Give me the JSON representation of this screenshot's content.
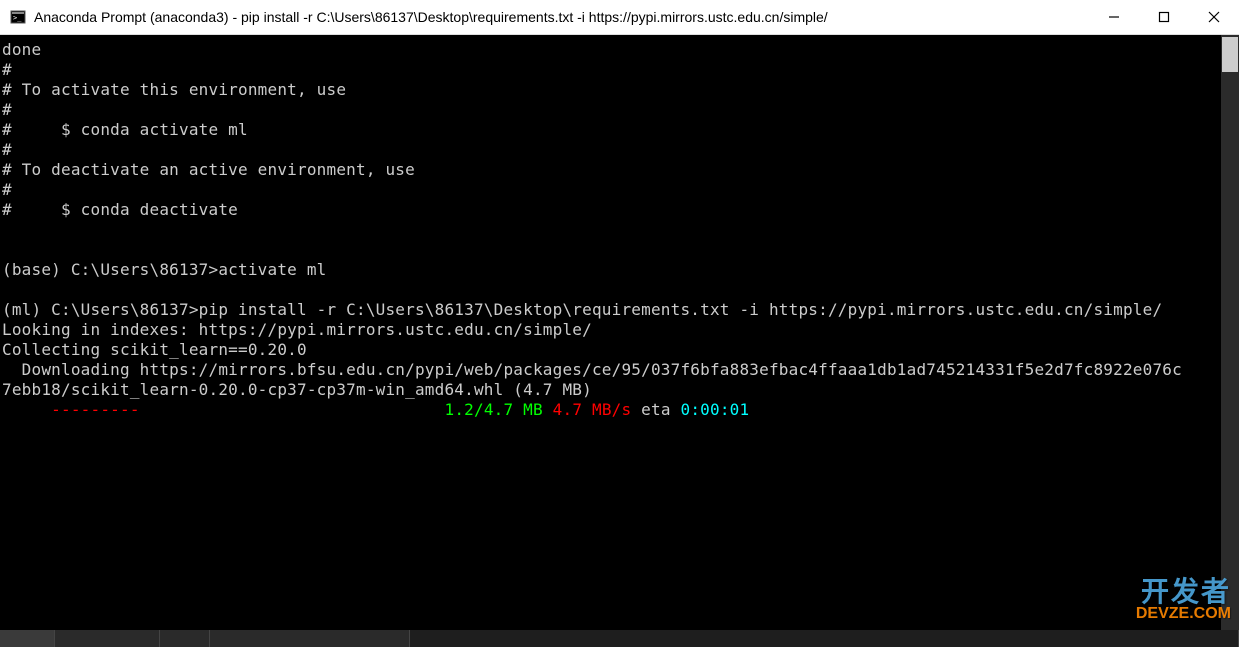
{
  "titlebar": {
    "title": "Anaconda Prompt (anaconda3) - pip  install -r C:\\Users\\86137\\Desktop\\requirements.txt -i https://pypi.mirrors.ustc.edu.cn/simple/"
  },
  "terminal": {
    "lines": [
      {
        "segments": [
          {
            "text": "done",
            "color": "gray"
          }
        ]
      },
      {
        "segments": [
          {
            "text": "#",
            "color": "gray"
          }
        ]
      },
      {
        "segments": [
          {
            "text": "# To activate this environment, use",
            "color": "gray"
          }
        ]
      },
      {
        "segments": [
          {
            "text": "#",
            "color": "gray"
          }
        ]
      },
      {
        "segments": [
          {
            "text": "#     $ conda activate ml",
            "color": "gray"
          }
        ]
      },
      {
        "segments": [
          {
            "text": "#",
            "color": "gray"
          }
        ]
      },
      {
        "segments": [
          {
            "text": "# To deactivate an active environment, use",
            "color": "gray"
          }
        ]
      },
      {
        "segments": [
          {
            "text": "#",
            "color": "gray"
          }
        ]
      },
      {
        "segments": [
          {
            "text": "#     $ conda deactivate",
            "color": "gray"
          }
        ]
      },
      {
        "segments": [
          {
            "text": "",
            "color": "gray"
          }
        ]
      },
      {
        "segments": [
          {
            "text": "",
            "color": "gray"
          }
        ]
      },
      {
        "segments": [
          {
            "text": "(base) C:\\Users\\86137>activate ml",
            "color": "gray"
          }
        ]
      },
      {
        "segments": [
          {
            "text": "",
            "color": "gray"
          }
        ]
      },
      {
        "segments": [
          {
            "text": "(ml) C:\\Users\\86137>pip install -r C:\\Users\\86137\\Desktop\\requirements.txt -i https://pypi.mirrors.ustc.edu.cn/simple/",
            "color": "gray"
          }
        ]
      },
      {
        "segments": [
          {
            "text": "Looking in indexes: https://pypi.mirrors.ustc.edu.cn/simple/",
            "color": "gray"
          }
        ]
      },
      {
        "segments": [
          {
            "text": "Collecting scikit_learn==0.20.0",
            "color": "gray"
          }
        ]
      },
      {
        "segments": [
          {
            "text": "  Downloading https://mirrors.bfsu.edu.cn/pypi/web/packages/ce/95/037f6bfa883efbac4ffaaa1db1ad745214331f5e2d7fc8922e076c",
            "color": "gray"
          }
        ]
      },
      {
        "segments": [
          {
            "text": "7ebb18/scikit_learn-0.20.0-cp37-cp37m-win_amd64.whl (4.7 MB)",
            "color": "gray"
          }
        ]
      },
      {
        "segments": [
          {
            "text": "     ",
            "color": "gray"
          },
          {
            "text": "---------",
            "color": "red"
          },
          {
            "text": "                               ",
            "color": "gray"
          },
          {
            "text": "1.2/4.7 MB",
            "color": "green"
          },
          {
            "text": " ",
            "color": "gray"
          },
          {
            "text": "4.7 MB/s",
            "color": "red"
          },
          {
            "text": " eta ",
            "color": "gray"
          },
          {
            "text": "0:00:01",
            "color": "cyan"
          }
        ]
      }
    ]
  },
  "watermark": {
    "top": "开发者",
    "bottom": "DEVZE.COM"
  }
}
